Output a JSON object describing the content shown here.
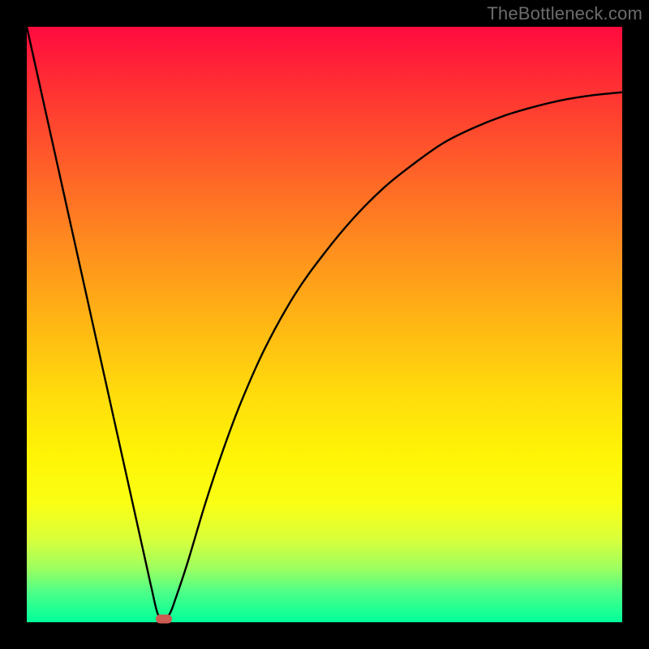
{
  "watermark": "TheBottleneck.com",
  "chart_data": {
    "type": "line",
    "title": "",
    "xlabel": "",
    "ylabel": "",
    "xlim": [
      0,
      100
    ],
    "ylim": [
      0,
      100
    ],
    "grid": false,
    "series": [
      {
        "name": "curve",
        "x": [
          0,
          2,
          4,
          6,
          8,
          10,
          12,
          14,
          16,
          18,
          20,
          21,
          22,
          23,
          24,
          25,
          27,
          30,
          33,
          36,
          40,
          45,
          50,
          55,
          60,
          65,
          70,
          75,
          80,
          85,
          90,
          95,
          100
        ],
        "y": [
          100,
          91,
          82,
          73,
          64,
          55,
          46,
          37,
          28,
          19,
          10,
          5.5,
          1.4,
          0.5,
          1.4,
          4,
          10,
          20,
          29,
          37,
          46,
          55,
          62,
          68,
          73,
          77,
          80.5,
          83,
          85,
          86.5,
          87.7,
          88.5,
          89
        ]
      }
    ],
    "marker": {
      "x": 23,
      "y": 0.5,
      "color": "#cc5b52"
    },
    "background_gradient": {
      "top": "#ff0b3f",
      "bottom": "#00ff9a"
    }
  }
}
